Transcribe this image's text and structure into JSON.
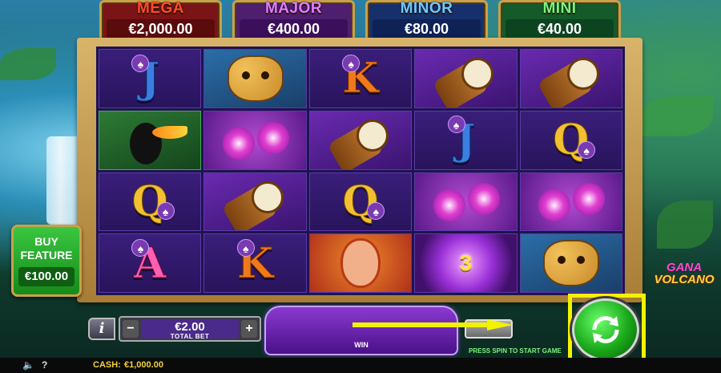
{
  "jackpots": {
    "mega": {
      "label": "MEGA",
      "value": "€2,000.00"
    },
    "major": {
      "label": "MAJOR",
      "value": "€400.00"
    },
    "minor": {
      "label": "MINOR",
      "value": "€80.00"
    },
    "mini": {
      "label": "MINI",
      "value": "€40.00"
    }
  },
  "reels": [
    [
      {
        "symbol": "J",
        "kind": "letter"
      },
      {
        "symbol": "jaguar",
        "kind": "pic"
      },
      {
        "symbol": "K",
        "kind": "letter"
      },
      {
        "symbol": "drum",
        "kind": "pic"
      },
      {
        "symbol": "drum",
        "kind": "pic"
      }
    ],
    [
      {
        "symbol": "toucan",
        "kind": "pic"
      },
      {
        "symbol": "orchid",
        "kind": "pic"
      },
      {
        "symbol": "drum",
        "kind": "pic"
      },
      {
        "symbol": "J",
        "kind": "letter"
      },
      {
        "symbol": "Q",
        "kind": "letter"
      }
    ],
    [
      {
        "symbol": "Q",
        "kind": "letter"
      },
      {
        "symbol": "drum",
        "kind": "pic"
      },
      {
        "symbol": "Q",
        "kind": "letter"
      },
      {
        "symbol": "orchid",
        "kind": "pic"
      },
      {
        "symbol": "orchid",
        "kind": "pic"
      }
    ],
    [
      {
        "symbol": "A",
        "kind": "letter"
      },
      {
        "symbol": "K",
        "kind": "letter"
      },
      {
        "symbol": "woman",
        "kind": "pic"
      },
      {
        "symbol": "bonus",
        "kind": "pic",
        "value": "3"
      },
      {
        "symbol": "jaguar",
        "kind": "pic"
      }
    ]
  ],
  "buy_feature": {
    "label": "BUY FEATURE",
    "price": "€100.00"
  },
  "logo": {
    "line1": "GANA",
    "line2": "VOLCANO"
  },
  "bet": {
    "value": "€2.00",
    "label": "TOTAL BET",
    "minus": "−",
    "plus": "+"
  },
  "info": {
    "label": "i"
  },
  "win": {
    "label": "WIN"
  },
  "press_spin_msg": "PRESS SPIN TO START GAME",
  "status": {
    "cash_label": "CASH:",
    "cash_value": "€1,000.00",
    "help": "?"
  },
  "colors": {
    "highlight": "#f2f200",
    "spin": "#1aa81a"
  },
  "icons": [
    "sound-icon",
    "help-icon",
    "spin-arrows-icon",
    "spade-icon"
  ]
}
